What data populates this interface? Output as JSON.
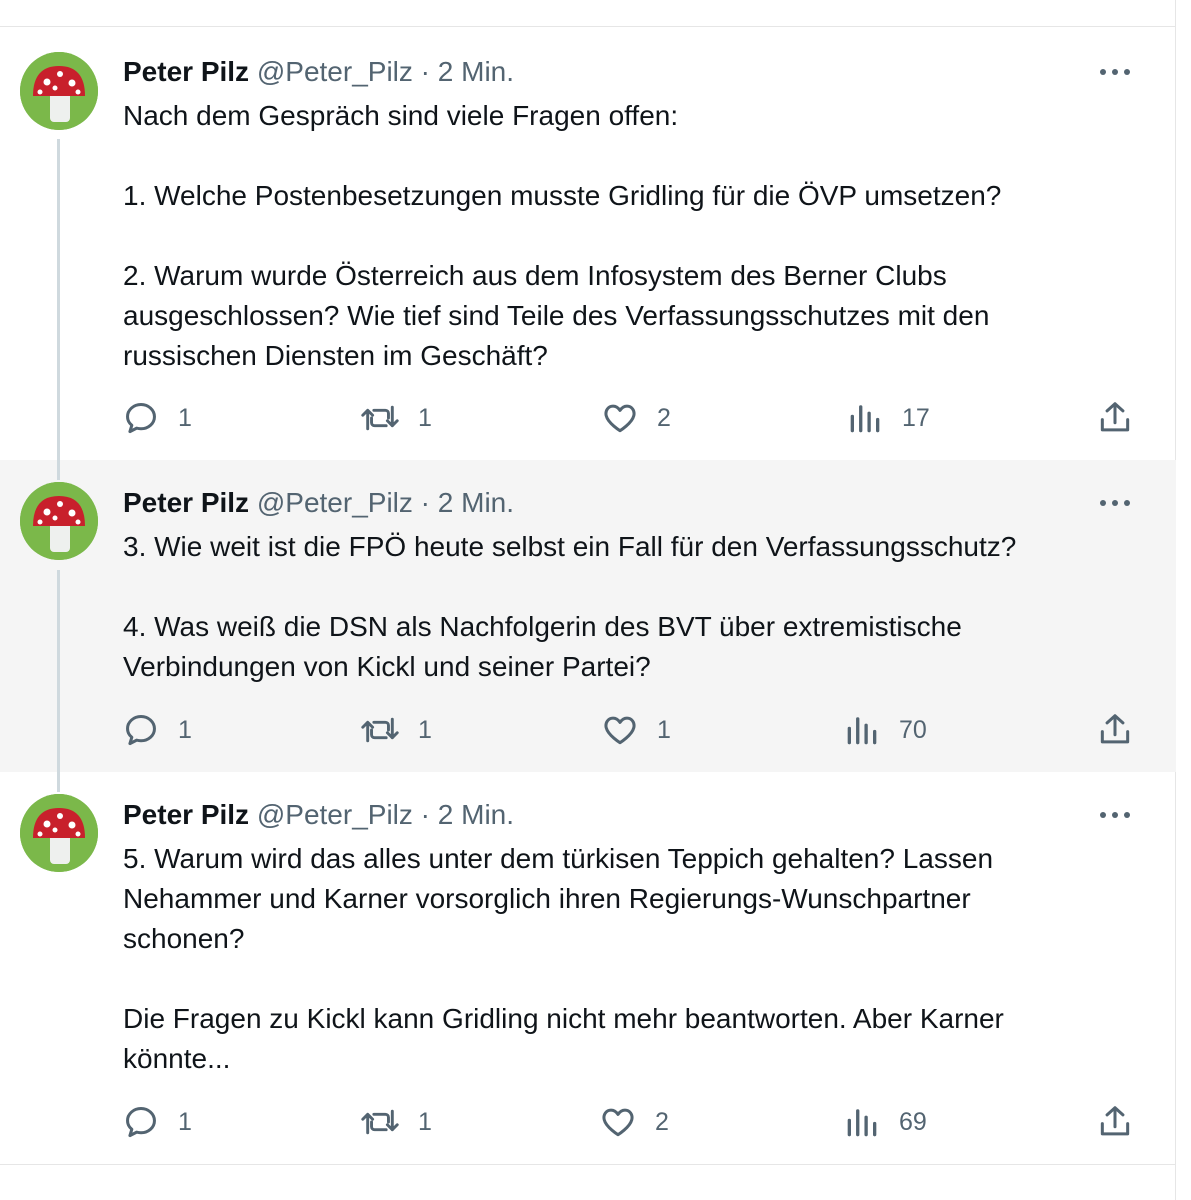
{
  "tweets": [
    {
      "author": "Peter Pilz",
      "handle": "@Peter_Pilz",
      "separator": "·",
      "time": "2 Min.",
      "paragraphs": [
        "Nach dem Gespräch sind viele Fragen offen:",
        "1. Welche Postenbesetzungen musste Gridling für die ÖVP umsetzen?",
        "2. Warum wurde Österreich aus dem Infosystem des Berner Clubs\nausgeschlossen? Wie tief sind Teile des Verfassungsschutzes mit den\nrussischen Diensten im Geschäft?"
      ],
      "replies": "1",
      "retweets": "1",
      "likes": "2",
      "views": "17"
    },
    {
      "author": "Peter Pilz",
      "handle": "@Peter_Pilz",
      "separator": "·",
      "time": "2 Min.",
      "paragraphs": [
        "3. Wie weit ist die FPÖ heute selbst ein Fall für den Verfassungsschutz?",
        "4. Was weiß die DSN als Nachfolgerin des BVT über extremistische\nVerbindungen von Kickl und seiner Partei?"
      ],
      "replies": "1",
      "retweets": "1",
      "likes": "1",
      "views": "70"
    },
    {
      "author": "Peter Pilz",
      "handle": "@Peter_Pilz",
      "separator": "·",
      "time": "2 Min.",
      "paragraphs": [
        "5. Warum wird das alles unter dem türkisen Teppich gehalten? Lassen\nNehammer und Karner vorsorglich ihren Regierungs-Wunschpartner\nschonen?",
        "Die Fragen zu Kickl kann Gridling nicht mehr beantworten. Aber Karner\nkönnte..."
      ],
      "replies": "1",
      "retweets": "1",
      "likes": "2",
      "views": "69"
    }
  ],
  "icons": {
    "avatar": "mushroom-avatar-icon",
    "more": "more-options-icon",
    "reply": "reply-icon",
    "retweet": "retweet-icon",
    "like": "heart-icon",
    "views": "views-icon",
    "share": "share-icon"
  },
  "colors": {
    "text": "#0f1419",
    "secondary": "#536471",
    "thread_line": "#cfd9de",
    "shaded_background": "#f5f5f5",
    "avatar_background": "#7bb84a",
    "mushroom_cap": "#c8202c"
  }
}
